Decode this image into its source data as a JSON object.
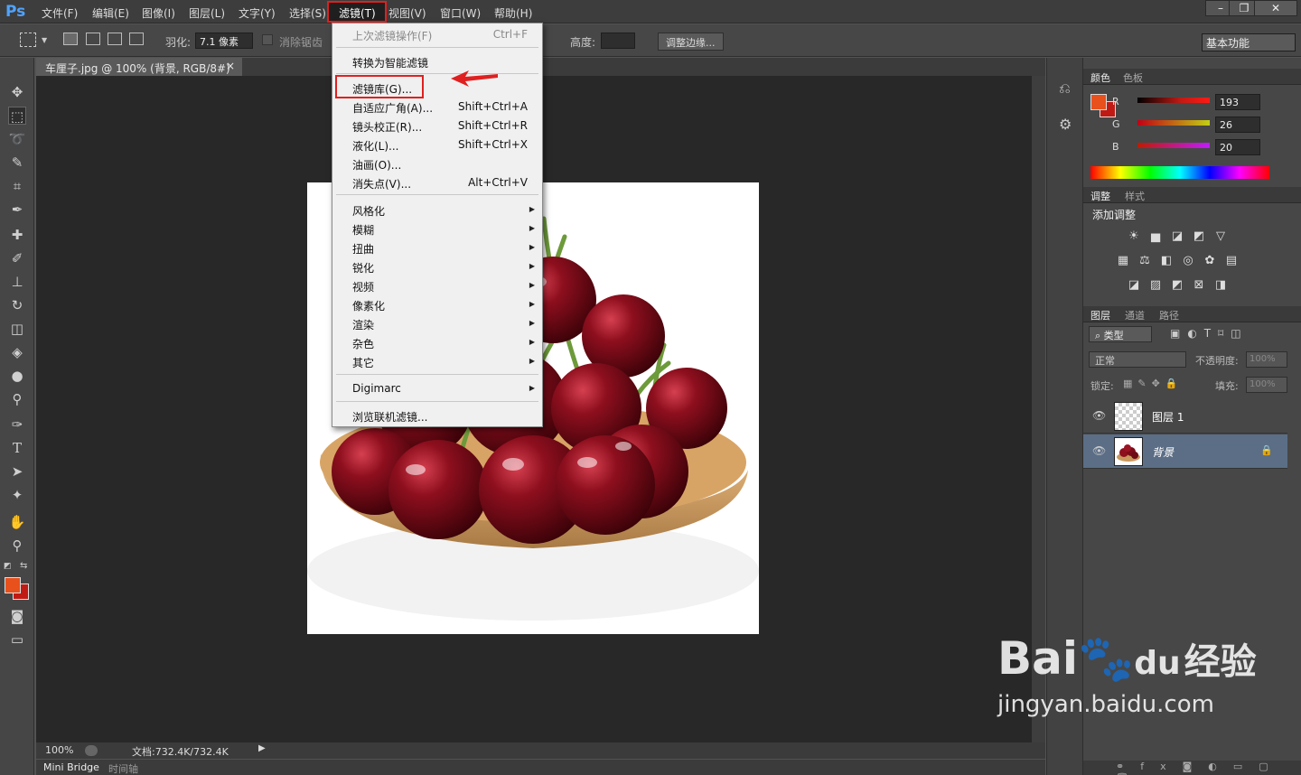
{
  "app": {
    "logo": "Ps"
  },
  "menubar": {
    "items": [
      "文件(F)",
      "编辑(E)",
      "图像(I)",
      "图层(L)",
      "文字(Y)",
      "选择(S)",
      "滤镜(T)",
      "视图(V)",
      "窗口(W)",
      "帮助(H)"
    ]
  },
  "window_controls": {
    "minimize": "–",
    "restore": "❐",
    "close": "✕"
  },
  "options": {
    "feather_label": "羽化:",
    "feather_value": "7.1 像素",
    "antialias_label": "消除锯齿",
    "height_label": "高度:",
    "refine_edge_label": "调整边缘...",
    "workspace_value": "基本功能"
  },
  "document": {
    "tab_title": "车厘子.jpg @ 100% (背景, RGB/8#) *",
    "tab_close": "×",
    "zoom": "100%",
    "doc_info": "文档:732.4K/732.4K"
  },
  "bottom_tabs": [
    "Mini Bridge",
    "时间轴"
  ],
  "filter_menu": {
    "last_filter": {
      "label": "上次滤镜操作(F)",
      "shortcut": "Ctrl+F"
    },
    "convert_smart": "转换为智能滤镜",
    "items_a": [
      {
        "label": "滤镜库(G)...",
        "shortcut": ""
      },
      {
        "label": "自适应广角(A)...",
        "shortcut": "Shift+Ctrl+A"
      },
      {
        "label": "镜头校正(R)...",
        "shortcut": "Shift+Ctrl+R"
      },
      {
        "label": "液化(L)...",
        "shortcut": "Shift+Ctrl+X"
      },
      {
        "label": "油画(O)...",
        "shortcut": ""
      },
      {
        "label": "消失点(V)...",
        "shortcut": "Alt+Ctrl+V"
      }
    ],
    "submenus": [
      "风格化",
      "模糊",
      "扭曲",
      "锐化",
      "视频",
      "像素化",
      "渲染",
      "杂色",
      "其它"
    ],
    "digimarc": "Digimarc",
    "browse_online": "浏览联机滤镜..."
  },
  "color_panel": {
    "tabs": [
      "颜色",
      "色板"
    ],
    "channels": [
      {
        "name": "R",
        "value": "193"
      },
      {
        "name": "G",
        "value": "26"
      },
      {
        "name": "B",
        "value": "20"
      }
    ],
    "foreground": "#c11a14",
    "background": "#e8501c"
  },
  "adjust_panel": {
    "tabs": [
      "调整",
      "样式"
    ],
    "title": "添加调整"
  },
  "layers_panel": {
    "tabs": [
      "图层",
      "通道",
      "路径"
    ],
    "filter_type": "类型",
    "blend_mode": "正常",
    "opacity_label": "不透明度:",
    "opacity_value": "100%",
    "lock_label": "锁定:",
    "fill_label": "填充:",
    "fill_value": "100%",
    "layers": [
      {
        "name": "图层 1"
      },
      {
        "name": "背景"
      }
    ]
  },
  "watermark": {
    "brand": "Bai",
    "brand2": "du",
    "cn": "经验",
    "url": "jingyan.baidu.com"
  }
}
